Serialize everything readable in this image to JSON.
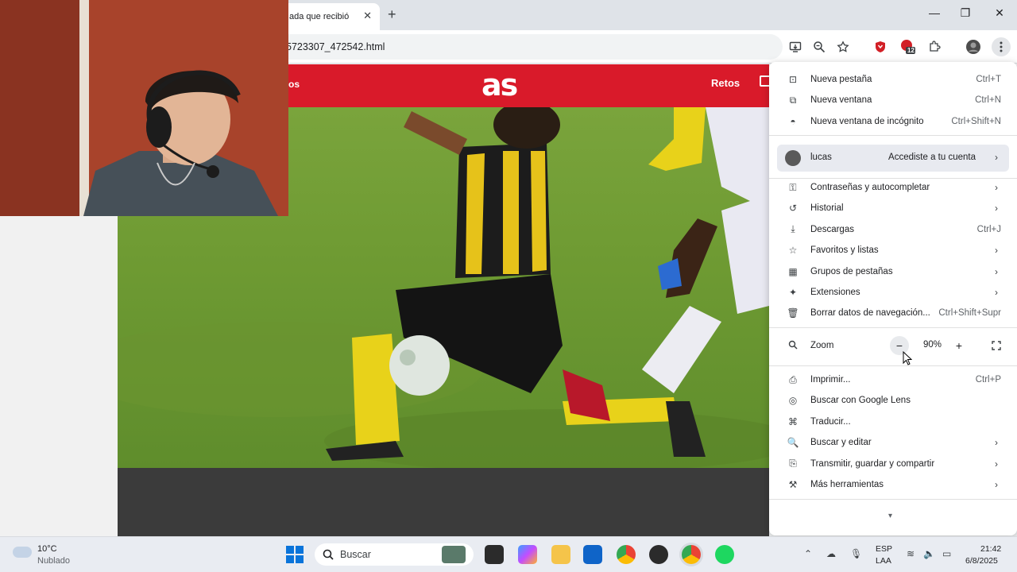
{
  "browser": {
    "tab_title": "ada que recibió",
    "new_tab_symbol": "+",
    "close_symbol": "✕",
    "url": "5723307_472542.html",
    "extension_badge": "12"
  },
  "page": {
    "nav_left": "os",
    "logo": "as",
    "nav_retos": "Retos"
  },
  "menu": {
    "group1": [
      {
        "label": "Nueva pestaña",
        "shortcut": "Ctrl+T",
        "icon": "new-tab-icon"
      },
      {
        "label": "Nueva ventana",
        "shortcut": "Ctrl+N",
        "icon": "new-window-icon"
      },
      {
        "label": "Nueva ventana de incógnito",
        "shortcut": "Ctrl+Shift+N",
        "icon": "incognito-icon"
      }
    ],
    "profile": {
      "name": "lucas",
      "status": "Accediste a tu cuenta"
    },
    "group2": [
      {
        "label": "Contraseñas y autocompletar",
        "shortcut": "",
        "arrow": true,
        "icon": "key-icon"
      },
      {
        "label": "Historial",
        "shortcut": "",
        "arrow": true,
        "icon": "history-icon"
      },
      {
        "label": "Descargas",
        "shortcut": "Ctrl+J",
        "arrow": false,
        "icon": "download-icon"
      },
      {
        "label": "Favoritos y listas",
        "shortcut": "",
        "arrow": true,
        "icon": "star-icon"
      },
      {
        "label": "Grupos de pestañas",
        "shortcut": "",
        "arrow": true,
        "icon": "tab-groups-icon"
      },
      {
        "label": "Extensiones",
        "shortcut": "",
        "arrow": true,
        "icon": "extensions-icon"
      },
      {
        "label": "Borrar datos de navegación...",
        "shortcut": "Ctrl+Shift+Supr",
        "arrow": false,
        "icon": "trash-icon"
      }
    ],
    "zoom": {
      "label": "Zoom",
      "value": "90%",
      "minus": "−",
      "plus": "+"
    },
    "group3": [
      {
        "label": "Imprimir...",
        "shortcut": "Ctrl+P",
        "arrow": false,
        "icon": "print-icon"
      },
      {
        "label": "Buscar con Google Lens",
        "shortcut": "",
        "arrow": false,
        "icon": "lens-icon"
      },
      {
        "label": "Traducir...",
        "shortcut": "",
        "arrow": false,
        "icon": "translate-icon"
      },
      {
        "label": "Buscar y editar",
        "shortcut": "",
        "arrow": true,
        "icon": "find-edit-icon"
      },
      {
        "label": "Transmitir, guardar y compartir",
        "shortcut": "",
        "arrow": true,
        "icon": "cast-icon"
      },
      {
        "label": "Más herramientas",
        "shortcut": "",
        "arrow": true,
        "icon": "toolbox-icon"
      }
    ],
    "more_symbol": "▾"
  },
  "taskbar": {
    "weather_temp": "10°C",
    "weather_desc": "Nublado",
    "search_placeholder": "Buscar",
    "lang_top": "ESP",
    "lang_bottom": "LAA",
    "time": "21:42",
    "date": "6/8/2025"
  },
  "colors": {
    "as_red": "#d91a2a",
    "windows_blue": "#0a74da"
  }
}
